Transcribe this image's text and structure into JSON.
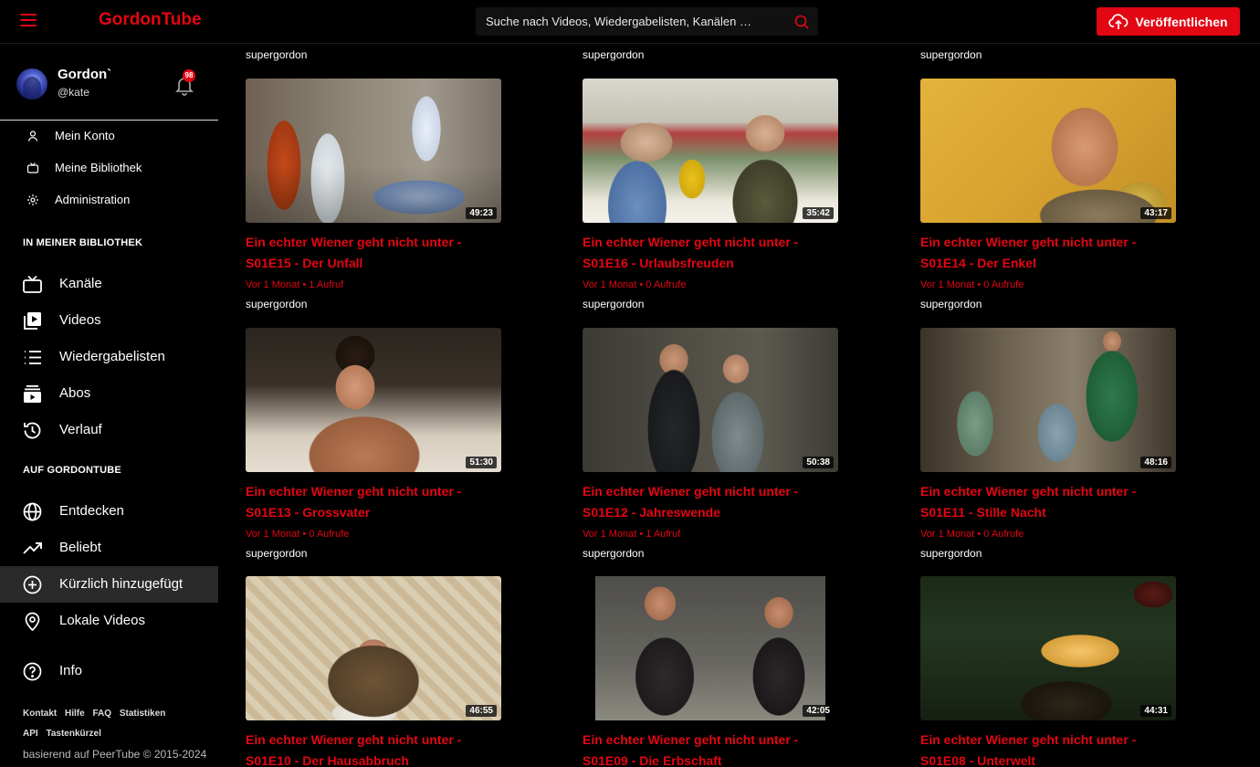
{
  "header": {
    "brand": "GordonTube",
    "search_placeholder": "Suche nach Videos, Wiedergabelisten, Kanälen …",
    "publish_label": "Veröffentlichen",
    "accent": "#e30613"
  },
  "user": {
    "name": "Gordon`",
    "handle": "@kate",
    "notifications": "98"
  },
  "account_menu": [
    {
      "label": "Mein Konto",
      "icon": "user-icon"
    },
    {
      "label": "Meine Bibliothek",
      "icon": "tv-icon"
    },
    {
      "label": "Administration",
      "icon": "gear-icon"
    }
  ],
  "sections": {
    "library": "IN MEINER BIBLIOTHEK",
    "instance": "AUF GORDONTUBE"
  },
  "library_nav": [
    {
      "label": "Kanäle",
      "icon": "tv-icon"
    },
    {
      "label": "Videos",
      "icon": "video-library-icon"
    },
    {
      "label": "Wiedergabelisten",
      "icon": "list-icon"
    },
    {
      "label": "Abos",
      "icon": "subscriptions-icon"
    },
    {
      "label": "Verlauf",
      "icon": "history-icon"
    }
  ],
  "instance_nav": [
    {
      "label": "Entdecken",
      "icon": "globe-icon"
    },
    {
      "label": "Beliebt",
      "icon": "trending-icon"
    },
    {
      "label": "Kürzlich hinzugefügt",
      "icon": "plus-circle-icon",
      "active": true
    },
    {
      "label": "Lokale Videos",
      "icon": "location-icon"
    }
  ],
  "info_nav": {
    "label": "Info",
    "icon": "help-icon"
  },
  "footer": {
    "links_row1": [
      "Kontakt",
      "Hilfe",
      "FAQ",
      "Statistiken"
    ],
    "links_row2": [
      "API",
      "Tastenkürzel"
    ],
    "copyright": "basierend auf PeerTube © 2015-2024"
  },
  "top_channels": [
    "supergordon",
    "supergordon",
    "supergordon"
  ],
  "videos": [
    {
      "title": "Ein echter Wiener geht nicht unter - S01E15 - Der Unfall",
      "duration": "49:23",
      "meta": "Vor 1 Monat • 1 Aufruf",
      "channel": "supergordon"
    },
    {
      "title": "Ein echter Wiener geht nicht unter - S01E16 - Urlaubsfreuden",
      "duration": "35:42",
      "meta": "Vor 1 Monat • 0 Aufrufe",
      "channel": "supergordon"
    },
    {
      "title": "Ein echter Wiener geht nicht unter - S01E14 - Der Enkel",
      "duration": "43:17",
      "meta": "Vor 1 Monat • 0 Aufrufe",
      "channel": "supergordon"
    },
    {
      "title": "Ein echter Wiener geht nicht unter - S01E13 - Grossvater",
      "duration": "51:30",
      "meta": "Vor 1 Monat • 0 Aufrufe",
      "channel": "supergordon"
    },
    {
      "title": "Ein echter Wiener geht nicht unter - S01E12 - Jahreswende",
      "duration": "50:38",
      "meta": "Vor 1 Monat • 1 Aufruf",
      "channel": "supergordon"
    },
    {
      "title": "Ein echter Wiener geht nicht unter - S01E11 - Stille Nacht",
      "duration": "48:16",
      "meta": "Vor 1 Monat • 0 Aufrufe",
      "channel": "supergordon"
    },
    {
      "title": "Ein echter Wiener geht nicht unter - S01E10 - Der Hausabbruch",
      "duration": "46:55",
      "meta": "",
      "channel": ""
    },
    {
      "title": "Ein echter Wiener geht nicht unter - S01E09 - Die Erbschaft",
      "duration": "42:05",
      "meta": "",
      "channel": ""
    },
    {
      "title": "Ein echter Wiener geht nicht unter - S01E08 - Unterwelt",
      "duration": "44:31",
      "meta": "",
      "channel": ""
    }
  ]
}
